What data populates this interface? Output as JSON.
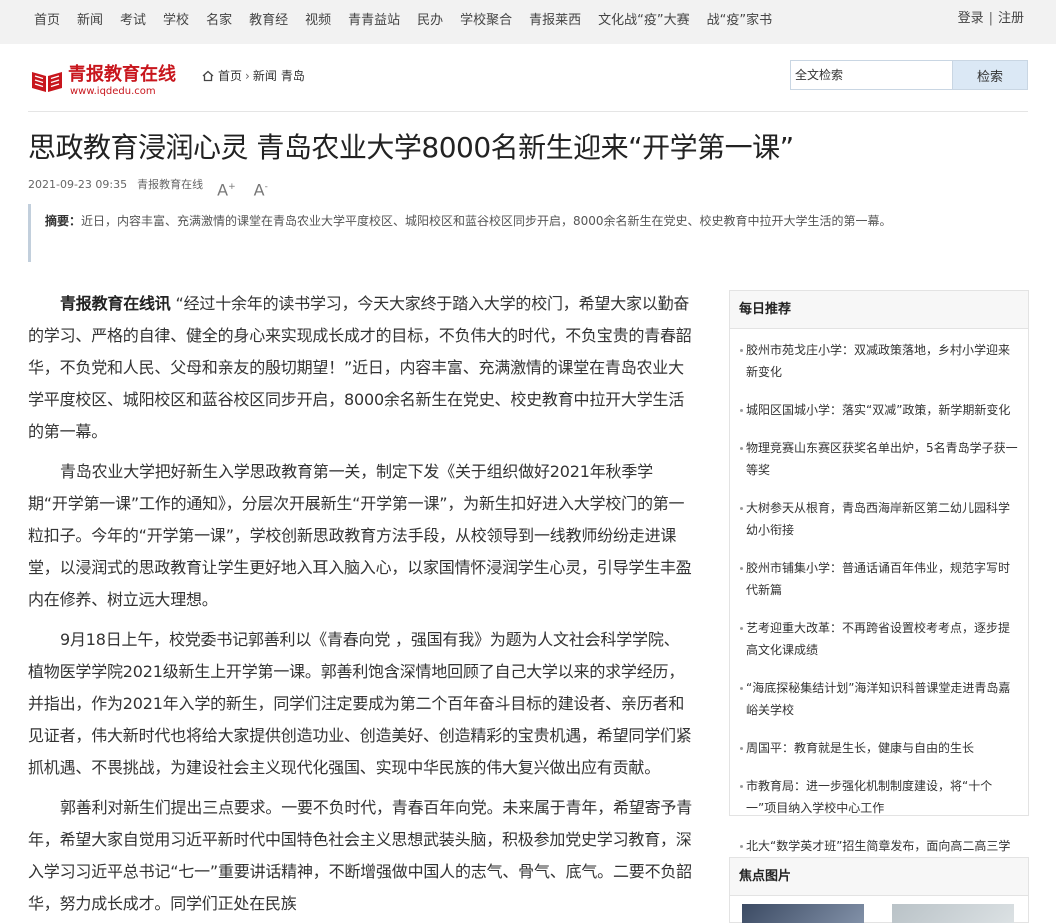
{
  "topnav": {
    "links": [
      "首页",
      "新闻",
      "考试",
      "学校",
      "名家",
      "教育经",
      "视频",
      "青青益站",
      "民办",
      "学校聚合",
      "青报莱西",
      "文化战“疫”大赛",
      "战“疫”家书"
    ],
    "login": "登录",
    "register": "注册"
  },
  "header": {
    "logo_name": "青报教育在线",
    "logo_url": "www.iqdedu.com",
    "breadcrumb": [
      "首页",
      "新闻",
      "青岛"
    ],
    "search_placeholder": "全文检索",
    "search_button": "检索"
  },
  "article": {
    "title": "思政教育浸润心灵 青岛农业大学8000名新生迎来“开学第一课”",
    "datetime": "2021-09-23 09:35",
    "source": "青报教育在线",
    "font_increase": "A",
    "font_decrease": "A",
    "summary_label": "摘要：",
    "summary": "近日，内容丰富、充满激情的课堂在青岛农业大学平度校区、城阳校区和蓝谷校区同步开启，8000余名新生在党史、校史教育中拉开大学生活的第一幕。",
    "lead_source": "青报教育在线讯",
    "paragraphs": [
      "“经过十余年的读书学习，今天大家终于踏入大学的校门，希望大家以勤奋的学习、严格的自律、健全的身心来实现成长成才的目标，不负伟大的时代，不负宝贵的青春韶华，不负党和人民、父母和亲友的殷切期望！”近日，内容丰富、充满激情的课堂在青岛农业大学平度校区、城阳校区和蓝谷校区同步开启，8000余名新生在党史、校史教育中拉开大学生活的第一幕。",
      "青岛农业大学把好新生入学思政教育第一关，制定下发《关于组织做好2021年秋季学期“开学第一课”工作的通知》，分层次开展新生“开学第一课”，为新生扣好进入大学校门的第一粒扣子。今年的“开学第一课”，学校创新思政教育方法手段，从校领导到一线教师纷纷走进课堂，以浸润式的思政教育让学生更好地入耳入脑入心，以家国情怀浸润学生心灵，引导学生丰盈内在修养、树立远大理想。",
      "9月18日上午，校党委书记郭善利以《青春向党 ，强国有我》为题为人文社会科学学院、植物医学学院2021级新生上开学第一课。郭善利饱含深情地回顾了自己大学以来的求学经历，并指出，作为2021年入学的新生，同学们注定要成为第二个百年奋斗目标的建设者、亲历者和见证者，伟大新时代也将给大家提供创造功业、创造美好、创造精彩的宝贵机遇，希望同学们紧抓机遇、不畏挑战，为建设社会主义现代化强国、实现中华民族的伟大复兴做出应有贡献。",
      "郭善利对新生们提出三点要求。一要不负时代，青春百年向党。未来属于青年，希望寄予青年，希望大家自觉用习近平新时代中国特色社会主义思想武装头脑，积极参加党史学习教育，深入学习习近平总书记“七一”重要讲话精神，不断增强做中国人的志气、骨气、底气。二要不负韶华，努力成长成才。同学们正处在民族"
    ]
  },
  "sidebar": {
    "daily_title": "每日推荐",
    "daily_items": [
      "胶州市苑戈庄小学：双减政策落地，乡村小学迎来新变化",
      "城阳区国城小学：落实“双减”政策，新学期新变化",
      "物理竞赛山东赛区获奖名单出炉，5名青岛学子获一等奖",
      "大树参天从根育，青岛西海岸新区第二幼儿园科学幼小衔接",
      "胶州市铺集小学：普通话诵百年伟业，规范字写时代新篇",
      "艺考迎重大改革：不再跨省设置校考考点，逐步提高文化课成绩",
      "“海底探秘集结计划”海洋知识科普课堂走进青岛嘉峪关学校",
      "周国平：教育就是生长，健康与自由的生长",
      "市教育局：进一步强化机制制度建设，将“十个一”项目纳入学校中心工作",
      "北大“数学英才班”招生简章发布，面向高二高三学生"
    ],
    "pics_title": "焦点图片"
  }
}
